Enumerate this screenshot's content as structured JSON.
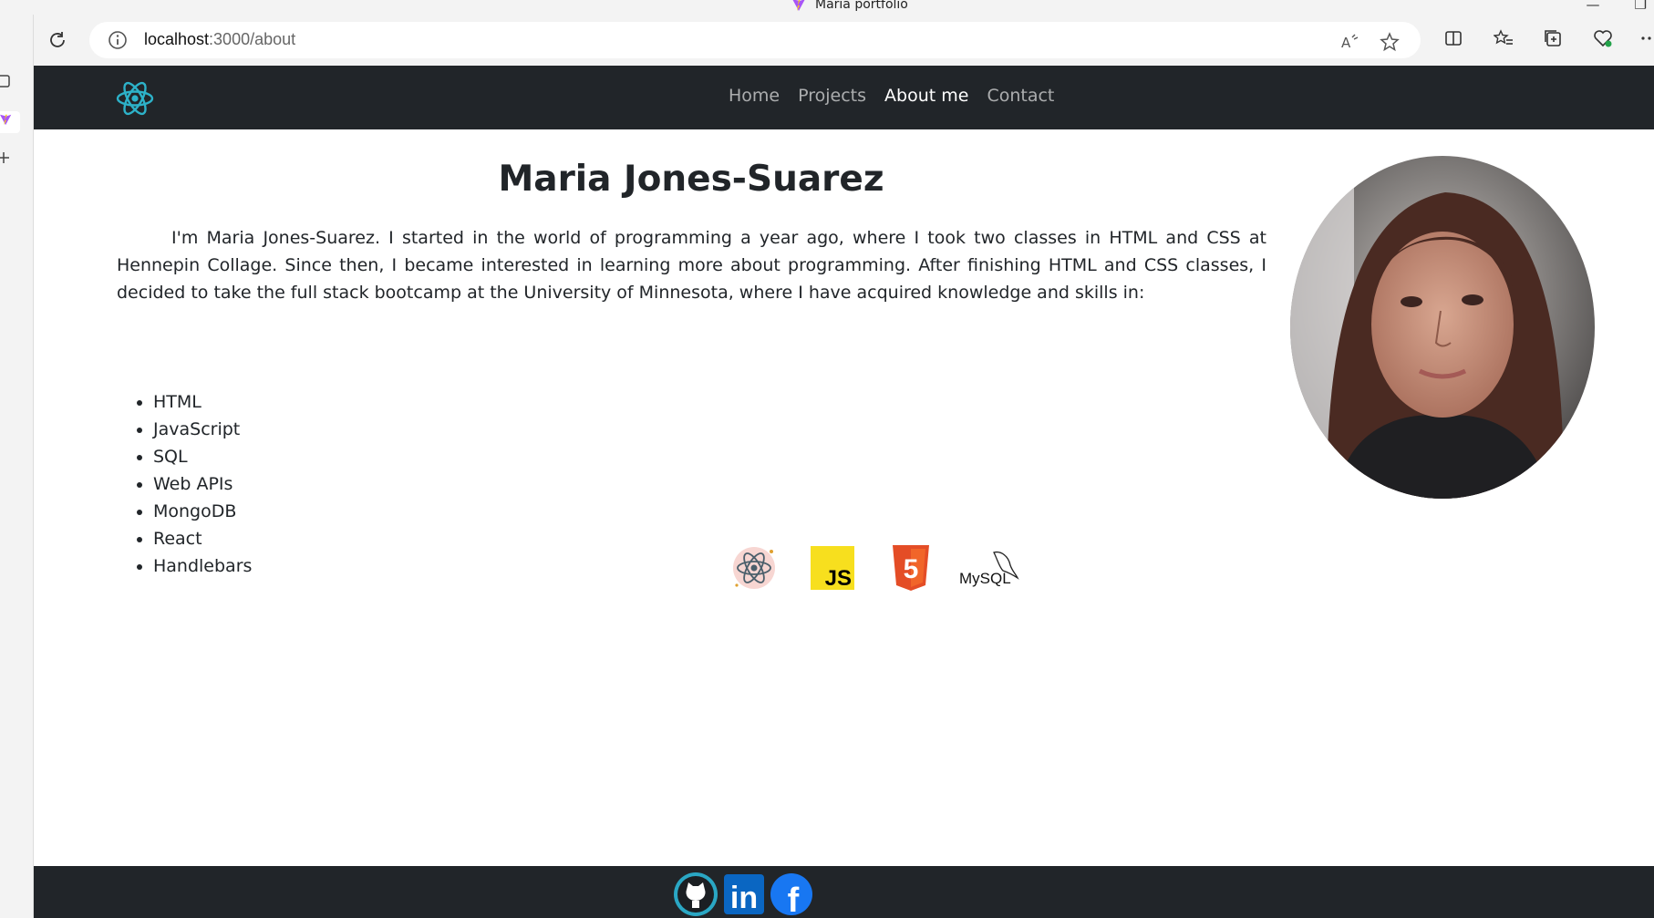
{
  "browser": {
    "tab_title": "Maria portfolio",
    "url_host": "localhost",
    "url_path": ":3000/about"
  },
  "nav": {
    "links": [
      "Home",
      "Projects",
      "About me",
      "Contact"
    ],
    "active": "About me",
    "brand_icon": "react-logo-icon"
  },
  "about": {
    "title": "Maria Jones-Suarez",
    "bio": "I'm Maria Jones-Suarez. I started in the world of programming a year ago, where I took two classes in HTML and CSS at Hennepin Collage. Since then, I became interested in learning more about programming. After finishing HTML and CSS classes, I decided to take the full stack bootcamp at the University of Minnesota, where I have acquired knowledge and skills in:",
    "skills": [
      "HTML",
      "JavaScript",
      "SQL",
      "Web APIs",
      "MongoDB",
      "React",
      "Handlebars"
    ]
  },
  "tech_icons": {
    "react": "react-icon",
    "js_label": "JS",
    "html5_label": "5",
    "mysql_label": "MySQL"
  },
  "footer": {
    "socials": [
      "github-icon",
      "linkedin-icon",
      "facebook-icon"
    ],
    "linkedin_label": "in",
    "facebook_label": "f"
  },
  "colors": {
    "navbar": "#212529",
    "js_yellow": "#f7df1e",
    "html5_orange": "#e44d26",
    "linkedin_blue": "#0a66c2",
    "facebook_blue": "#1877f2"
  }
}
